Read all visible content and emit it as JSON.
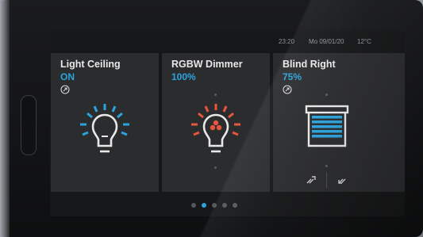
{
  "status": {
    "time": "23:20",
    "date": "Mo 09/01/20",
    "temperature": "12°C"
  },
  "tiles": [
    {
      "title": "Light Ceiling",
      "value": "ON",
      "icon": "lightbulb-icon",
      "color": "#2ba4dd"
    },
    {
      "title": "RGBW Dimmer",
      "value": "100%",
      "icon": "rgb-lightbulb-icon",
      "color": "#e8553e"
    },
    {
      "title": "Blind Right",
      "value": "75%",
      "icon": "blind-icon",
      "color": "#2ba4dd",
      "blind_controls": [
        "blind-close-icon",
        "blind-open-icon"
      ]
    }
  ],
  "pager": {
    "pages": 5,
    "active": 2
  },
  "colors": {
    "accent": "#2ba4dd",
    "rgb_accent": "#e8553e",
    "tile_bg": "#2b2c2e",
    "screen_bg": "#161718"
  }
}
